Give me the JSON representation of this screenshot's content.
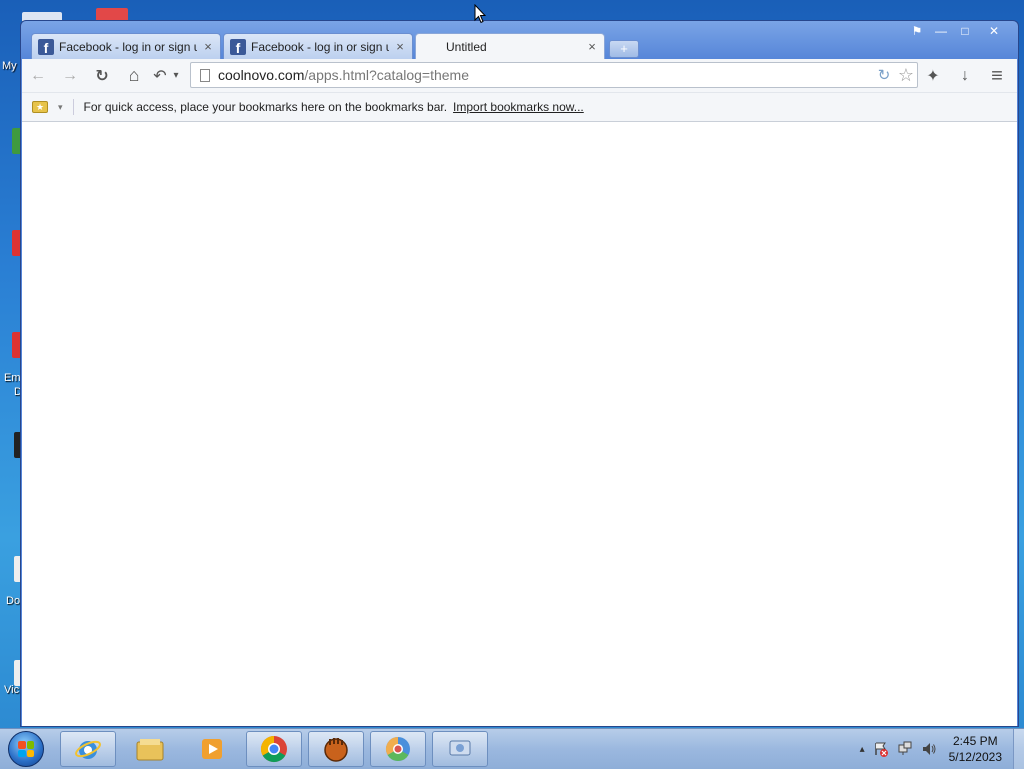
{
  "desktop": {
    "labels": [
      "My",
      "Em",
      "D",
      "Do",
      "Vic"
    ]
  },
  "window": {
    "controls": {
      "pin": "⚑",
      "minimize": "—",
      "maximize": "□",
      "close": "✕"
    }
  },
  "tabs": [
    {
      "title": "Facebook - log in or sign up",
      "icon": "facebook-icon",
      "close": "×"
    },
    {
      "title": "Facebook - log in or sign up",
      "icon": "facebook-icon",
      "close": "×"
    },
    {
      "title": "Untitled",
      "icon": "",
      "close": "×"
    }
  ],
  "new_tab": "+",
  "toolbar": {
    "back": "←",
    "forward": "→",
    "reload": "↻",
    "home": "⌂",
    "undo": "↶",
    "undo_caret": "▾",
    "url_domain": "coolnovo.com",
    "url_rest": "/apps.html?catalog=theme",
    "refresh_icon": "↻",
    "star": "☆",
    "extensions": "✦",
    "download": "↓",
    "menu": "≡"
  },
  "bookmarks": {
    "caret": "▾",
    "message": "For quick access, place your bookmarks here on the bookmarks bar.",
    "import_link": "Import bookmarks now..."
  },
  "taskbar": {
    "apps": [
      "internet-explorer-icon",
      "file-explorer-icon",
      "media-player-icon",
      "chrome-icon",
      "glove-icon",
      "coolnovo-icon",
      "network-icon"
    ],
    "tray": {
      "arrow": "▴",
      "time": "2:45 PM",
      "date": "5/12/2023"
    }
  },
  "colors": {
    "window_frame": "#5484d8",
    "facebook": "#3b5998",
    "taskbar": "#9bb8df"
  }
}
